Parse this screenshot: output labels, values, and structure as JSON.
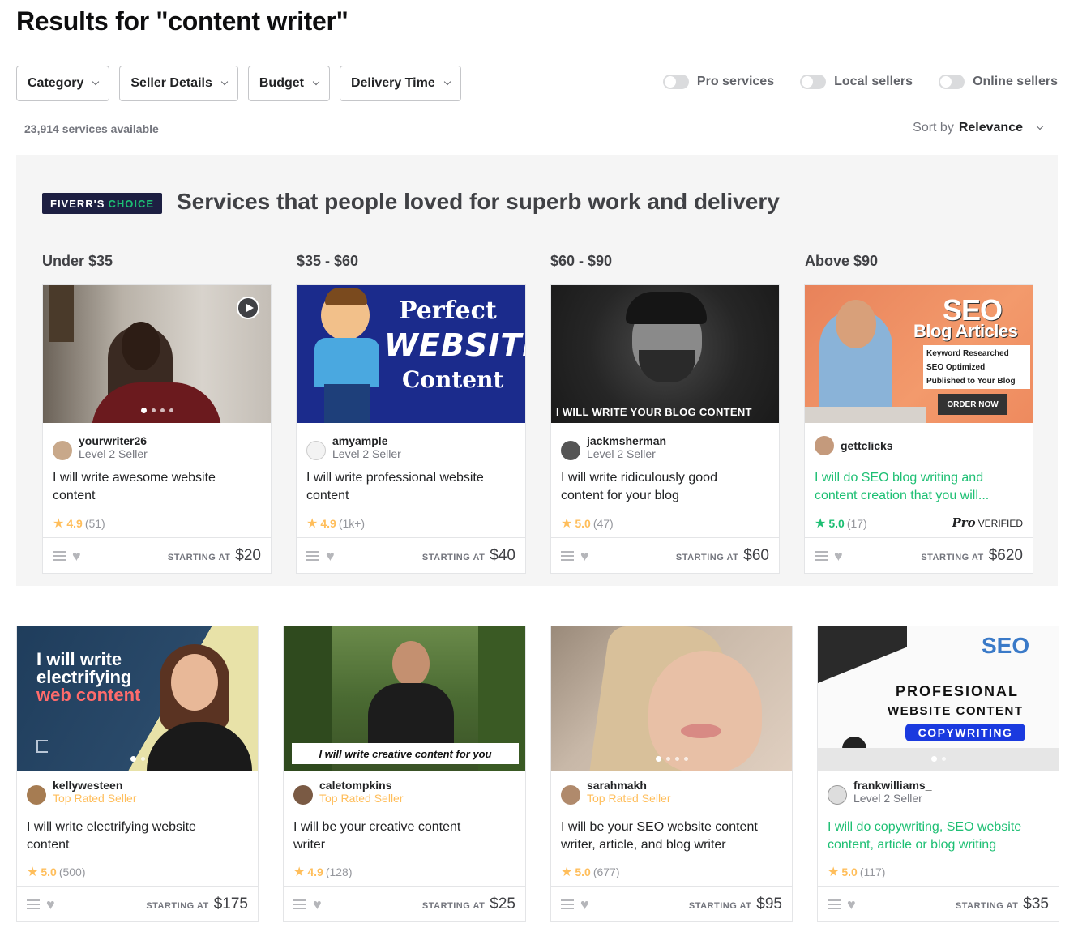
{
  "page": {
    "title": "Results for \"content writer\""
  },
  "filters": [
    "Category",
    "Seller Details",
    "Budget",
    "Delivery Time"
  ],
  "toggles": [
    "Pro services",
    "Local sellers",
    "Online sellers"
  ],
  "results": {
    "count_text": "23,914 services available",
    "sort_label": "Sort by",
    "sort_value": "Relevance"
  },
  "choice": {
    "badge_a": "FIVERR'S",
    "badge_b": "CHOICE",
    "heading": "Services that people loved for superb work and delivery",
    "columns": [
      "Under $35",
      "$35 - $60",
      "$60 - $90",
      "Above $90"
    ]
  },
  "price_label": "STARTING AT",
  "gigs": [
    {
      "seller": "yourwriter26",
      "level": "Level 2 Seller",
      "title_l1": "I will write awesome website",
      "title_l2": "content",
      "rating": "4.9",
      "reviews": "(51)",
      "price": "$20"
    },
    {
      "seller": "amyample",
      "level": "Level 2 Seller",
      "title_l1": "I will write professional website",
      "title_l2": "content",
      "rating": "4.9",
      "reviews": "(1k+)",
      "price": "$40"
    },
    {
      "seller": "jackmsherman",
      "level": "Level 2 Seller",
      "title_l1": "I will write ridiculously good",
      "title_l2": "content for your blog",
      "rating": "5.0",
      "reviews": "(47)",
      "price": "$60"
    },
    {
      "seller": "gettclicks",
      "level": "",
      "title_l1": "I will do SEO blog writing and",
      "title_l2": "content creation that you will...",
      "rating": "5.0",
      "reviews": "(17)",
      "price": "$620",
      "badge_pro": "Pro",
      "badge_verified": "VERIFIED"
    },
    {
      "seller": "kellywesteen",
      "level": "Top Rated Seller",
      "title_l1": "I will write electrifying website",
      "title_l2": "content",
      "rating": "5.0",
      "reviews": "(500)",
      "price": "$175"
    },
    {
      "seller": "caletompkins",
      "level": "Top Rated Seller",
      "title_l1": "I will be your creative content",
      "title_l2": "writer",
      "rating": "4.9",
      "reviews": "(128)",
      "price": "$25"
    },
    {
      "seller": "sarahmakh",
      "level": "Top Rated Seller",
      "title_l1": "I will be your SEO website content",
      "title_l2": "writer, article, and blog writer",
      "rating": "5.0",
      "reviews": "(677)",
      "price": "$95"
    },
    {
      "seller": "frankwilliams_",
      "level": "Level 2 Seller",
      "title_l1": "I will do copywriting, SEO website",
      "title_l2": "content, article or blog writing",
      "rating": "5.0",
      "reviews": "(117)",
      "price": "$35"
    }
  ],
  "thumbs": {
    "t2_l1": "Perfect",
    "t2_l2": "WEBSITE",
    "t2_l3": "Content",
    "t3": "I WILL WRITE YOUR BLOG CONTENT",
    "t4_l1": "SEO",
    "t4_l2": "Blog Articles",
    "t4_l3": "Keyword Researched",
    "t4_l4": "SEO Optimized",
    "t4_l5": "Published to Your Blog",
    "t4_btn": "ORDER NOW",
    "t5_l1": "I will write",
    "t5_l2": "electrifying",
    "t5_l3": "web content",
    "t6": "I will write creative content for you",
    "t8_logo": "SEO",
    "t8_l1": "PROFESIONAL",
    "t8_l2": "WEBSITE CONTENT",
    "t8_l3": "COPYWRITING"
  },
  "colors": {
    "brand_green": "#1dbf73",
    "star": "#ffbe5b",
    "badge_navy": "#1d1f42"
  }
}
